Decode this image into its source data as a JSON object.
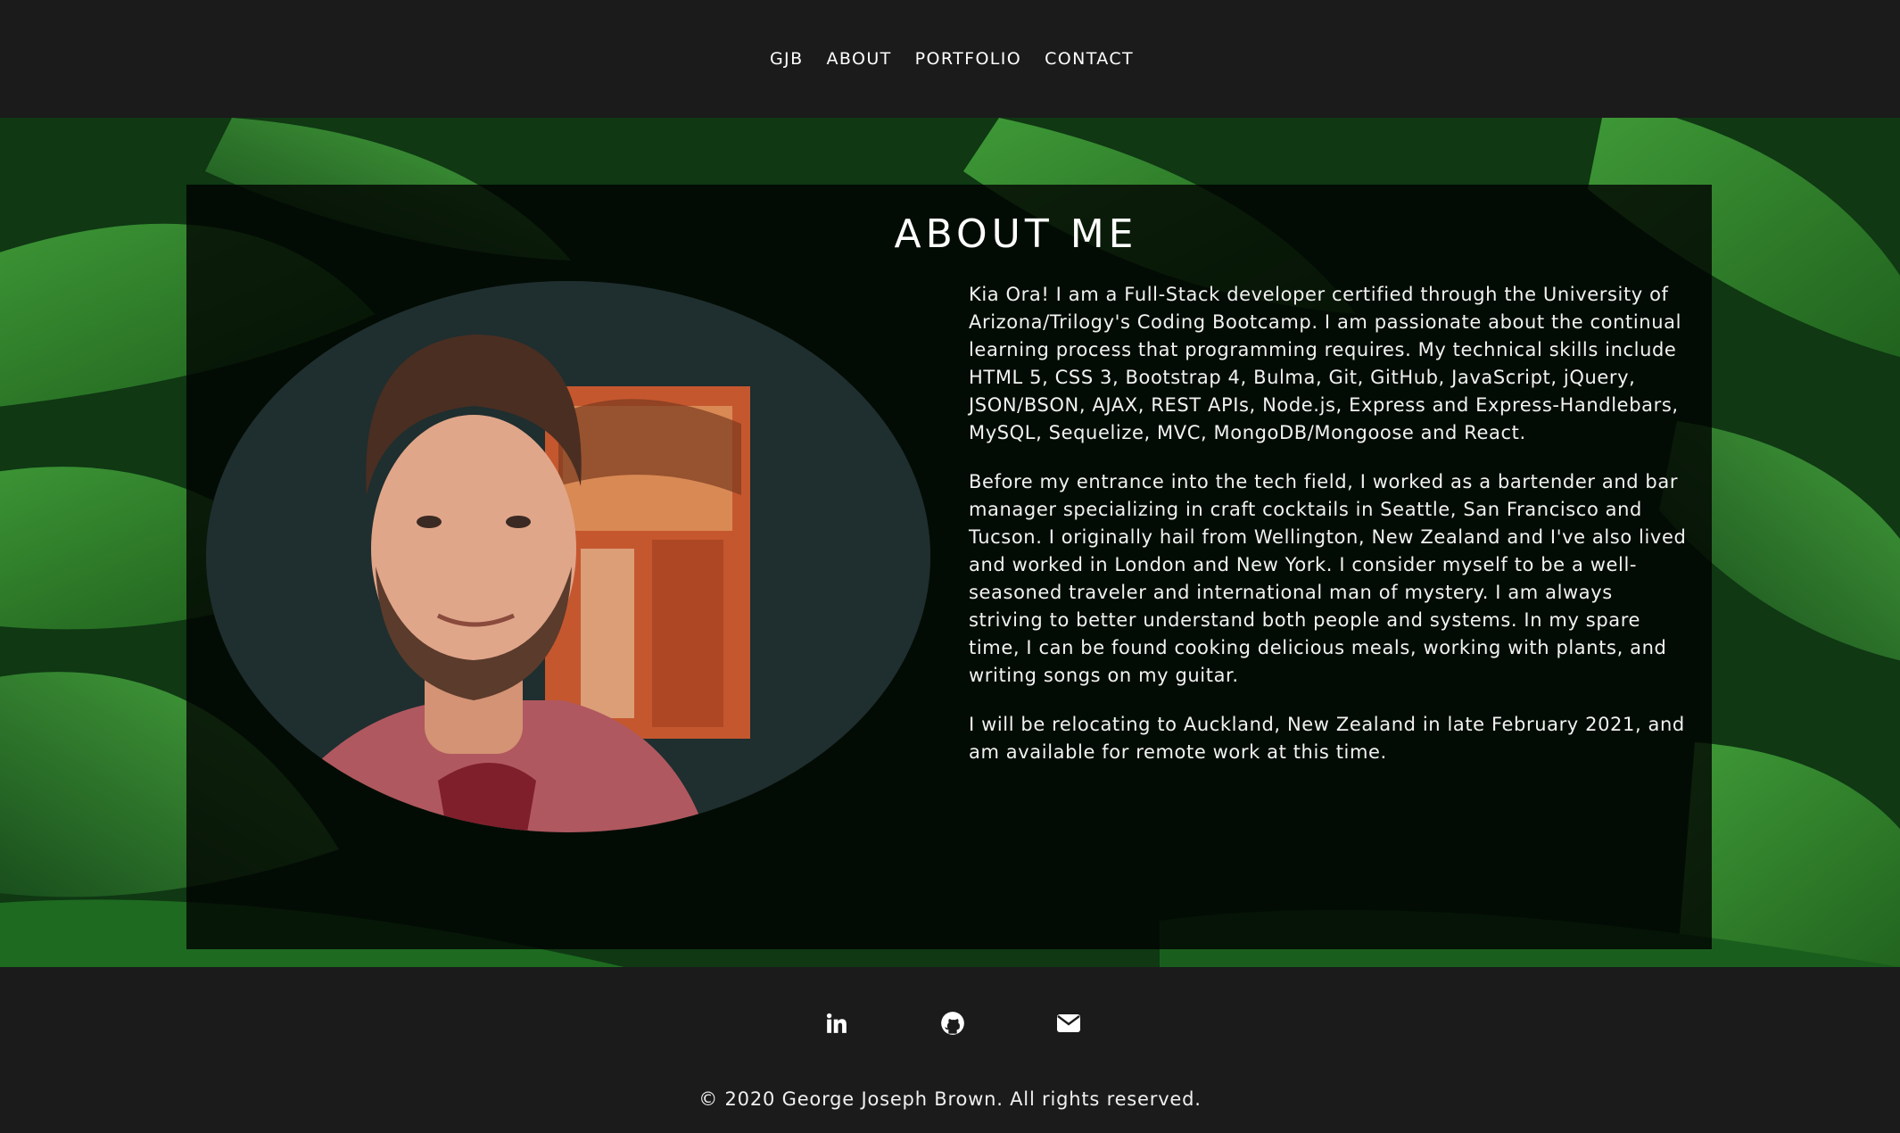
{
  "nav": {
    "items": [
      {
        "label": "GJB"
      },
      {
        "label": "ABOUT"
      },
      {
        "label": "PORTFOLIO"
      },
      {
        "label": "CONTACT"
      }
    ]
  },
  "about": {
    "title": "ABOUT ME",
    "paragraphs": [
      "Kia Ora! I am a Full-Stack developer certified through the University of Arizona/Trilogy's Coding Bootcamp. I am passionate about the continual learning process that programming requires. My technical skills include HTML 5, CSS 3, Bootstrap 4, Bulma, Git, GitHub, JavaScript, jQuery, JSON/BSON, AJAX, REST APIs, Node.js, Express and Express-Handlebars, MySQL, Sequelize, MVC, MongoDB/Mongoose and React.",
      "Before my entrance into the tech field, I worked as a bartender and bar manager specializing in craft cocktails in Seattle, San Francisco and Tucson. I originally hail from Wellington, New Zealand and I've also lived and worked in London and New York. I consider myself to be a well-seasoned traveler and international man of mystery. I am always striving to better understand both people and systems. In my spare time, I can be found cooking delicious meals, working with plants, and writing songs on my guitar.",
      "I will be relocating to Auckland, New Zealand in late February 2021, and am available for remote work at this time."
    ]
  },
  "footer": {
    "social": [
      {
        "icon": "linkedin-icon"
      },
      {
        "icon": "github-icon"
      },
      {
        "icon": "envelope-icon"
      }
    ],
    "copyright": "© 2020 George Joseph Brown. All rights reserved."
  },
  "colors": {
    "nav_bg": "#1b1b1b",
    "leaf_green": "#2f8a2c",
    "card_overlay": "rgba(0,0,0,0.78)"
  }
}
